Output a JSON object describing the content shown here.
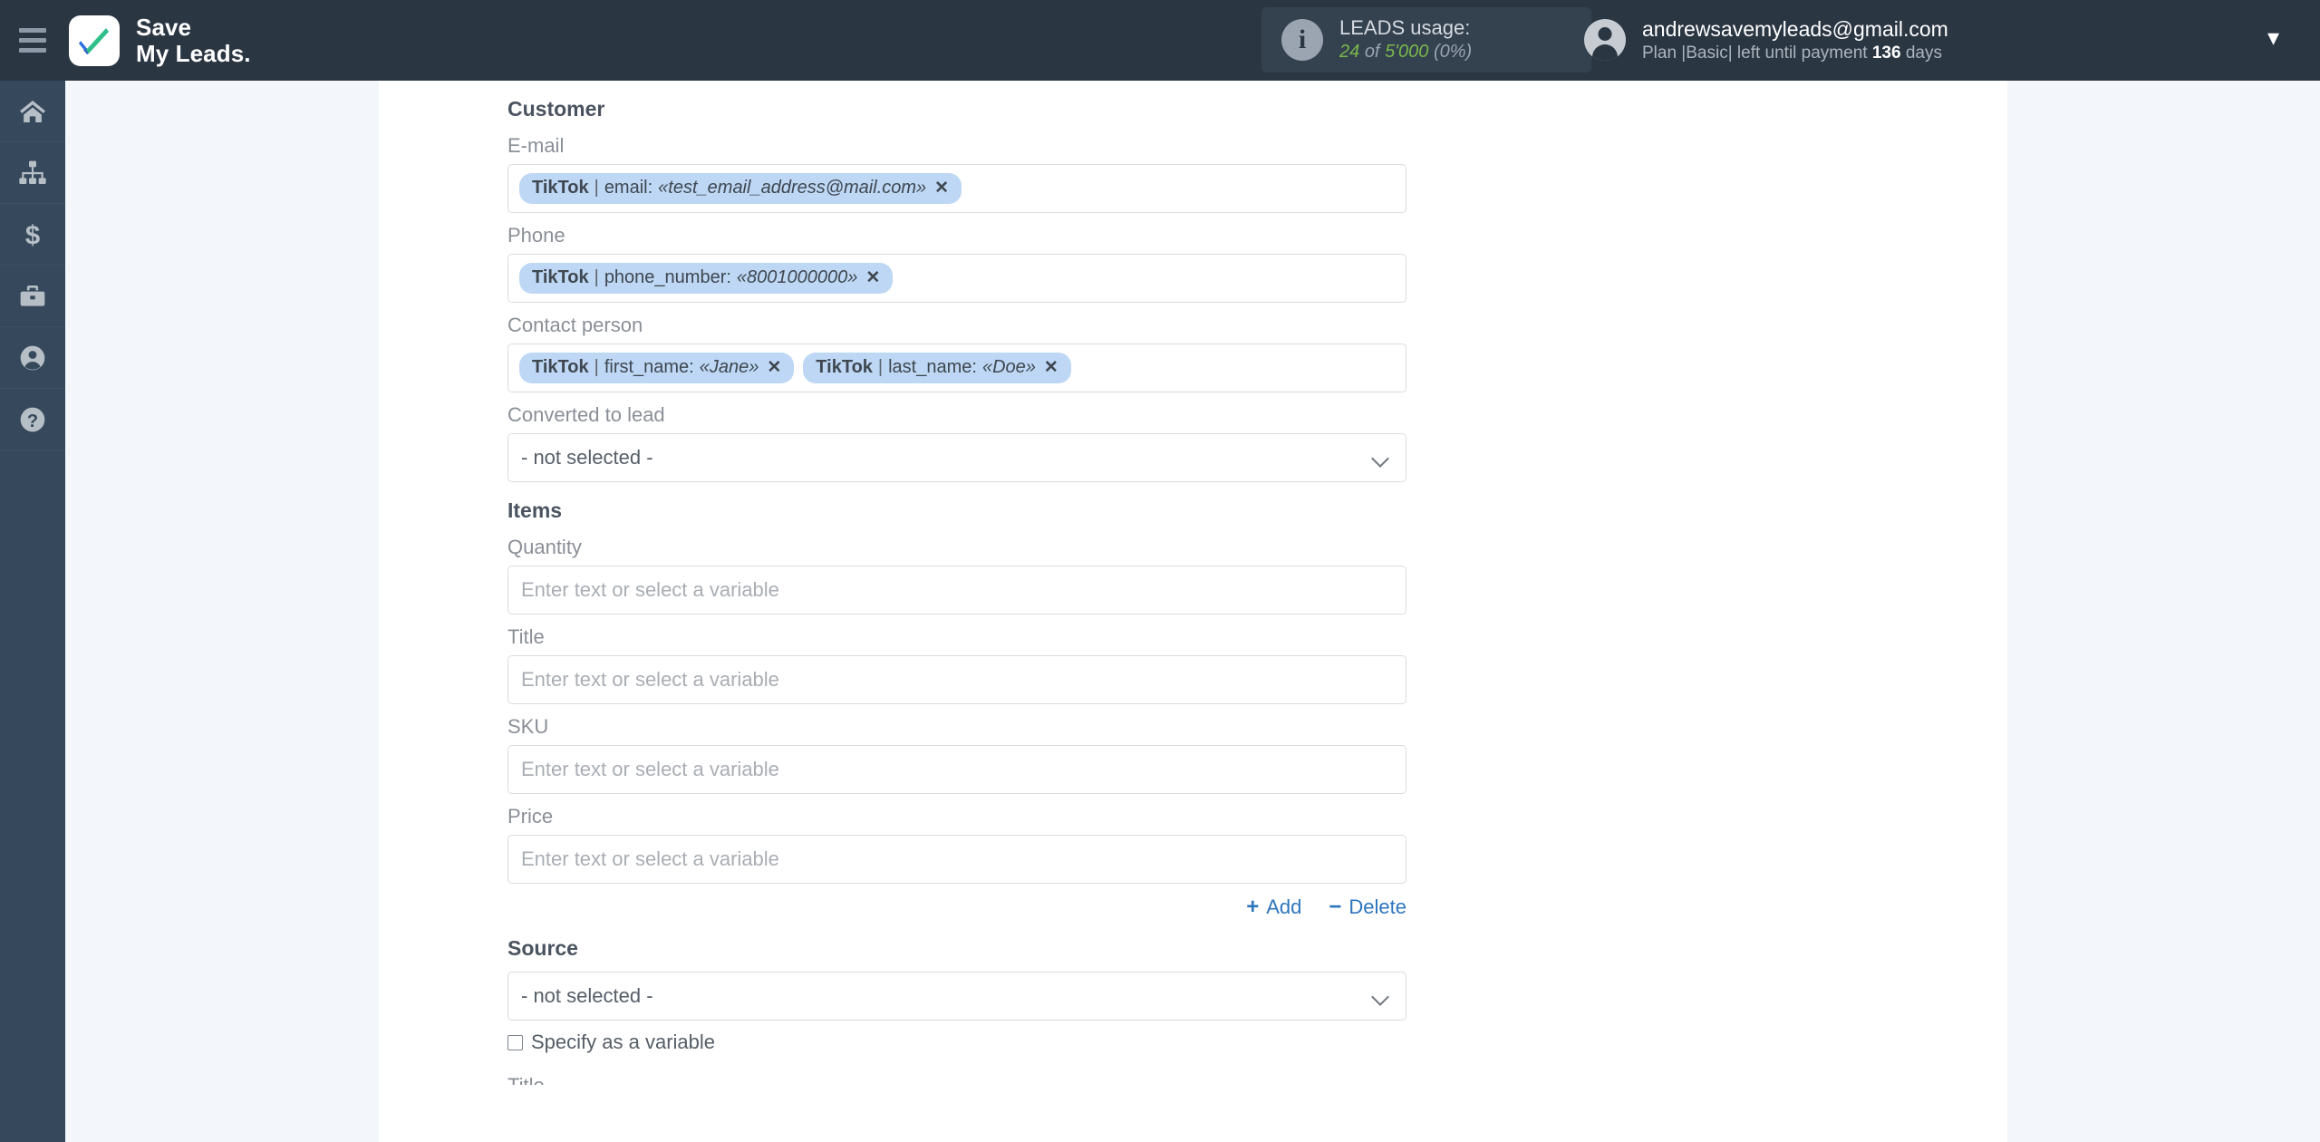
{
  "header": {
    "menu_icon": "hamburger-icon",
    "brand_line1": "Save",
    "brand_line2": "My Leads.",
    "usage": {
      "info_icon": "info-icon",
      "title": "LEADS usage:",
      "used": "24",
      "of_word": "of",
      "limit": "5'000",
      "percent": "(0%)"
    },
    "account": {
      "avatar_icon": "user-avatar-icon",
      "email": "andrewsavemyleads@gmail.com",
      "plan_prefix": "Plan |Basic| left until payment",
      "days": "136",
      "days_suffix": "days",
      "caret_icon": "chevron-down-icon"
    }
  },
  "sidebar": {
    "items": [
      {
        "icon": "home-icon",
        "name": "home"
      },
      {
        "icon": "sitemap-icon",
        "name": "connections"
      },
      {
        "icon": "dollar-icon",
        "name": "billing"
      },
      {
        "icon": "briefcase-icon",
        "name": "business"
      },
      {
        "icon": "user-circle-icon",
        "name": "profile"
      },
      {
        "icon": "question-circle-icon",
        "name": "help"
      }
    ]
  },
  "form": {
    "customer_section": "Customer",
    "email": {
      "label": "E-mail",
      "tags": [
        {
          "source": "TikTok",
          "sep": "|",
          "key": "email:",
          "value": "«test_email_address@mail.com»",
          "remove": "✕"
        }
      ]
    },
    "phone": {
      "label": "Phone",
      "tags": [
        {
          "source": "TikTok",
          "sep": "|",
          "key": "phone_number:",
          "value": "«8001000000»",
          "remove": "✕"
        }
      ]
    },
    "contact_person": {
      "label": "Contact person",
      "tags": [
        {
          "source": "TikTok",
          "sep": "|",
          "key": "first_name:",
          "value": "«Jane»",
          "remove": "✕"
        },
        {
          "source": "TikTok",
          "sep": "|",
          "key": "last_name:",
          "value": "«Doe»",
          "remove": "✕"
        }
      ]
    },
    "converted_to_lead": {
      "label": "Converted to lead",
      "value": "- not selected -"
    },
    "items_section": "Items",
    "quantity": {
      "label": "Quantity",
      "placeholder": "Enter text or select a variable",
      "value": ""
    },
    "title": {
      "label": "Title",
      "placeholder": "Enter text or select a variable",
      "value": ""
    },
    "sku": {
      "label": "SKU",
      "placeholder": "Enter text or select a variable",
      "value": ""
    },
    "price": {
      "label": "Price",
      "placeholder": "Enter text or select a variable",
      "value": ""
    },
    "add_label": "Add",
    "add_glyph": "+",
    "delete_label": "Delete",
    "delete_glyph": "−",
    "source": {
      "label": "Source",
      "value": "- not selected -"
    },
    "specify_variable": "Specify as a variable",
    "cut_off_label": "Title"
  },
  "colors": {
    "header_bg": "#2b3643",
    "rail_bg": "#36485c",
    "page_bg": "#f3f6fb",
    "panel_bg": "#ffffff",
    "tag_bg": "#bdd7f4",
    "link": "#2e75bd",
    "usage_green": "#7ab84c"
  }
}
